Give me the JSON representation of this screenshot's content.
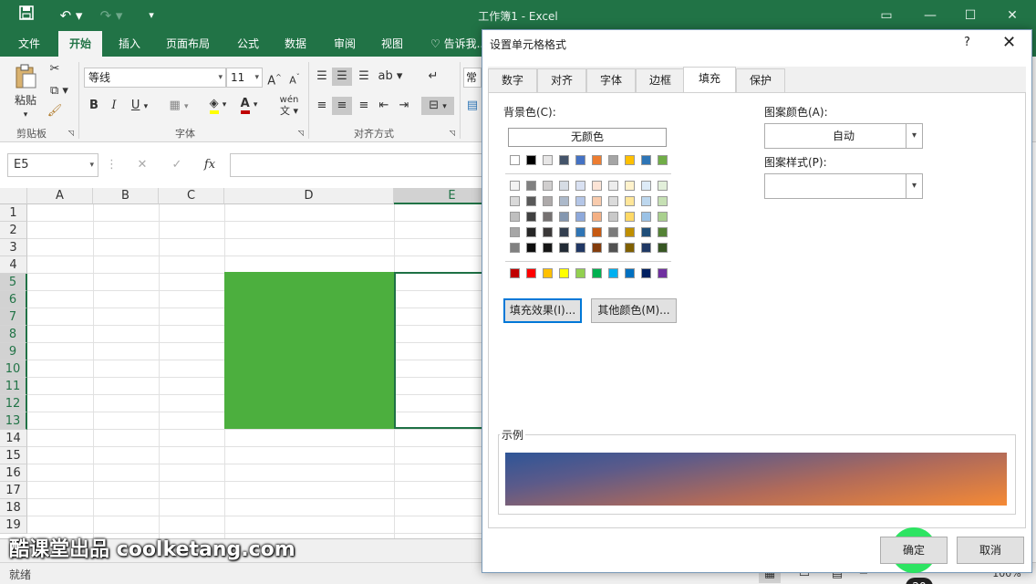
{
  "app": {
    "title": "工作簿1 - Excel"
  },
  "ribbon": {
    "tabs": [
      "文件",
      "开始",
      "插入",
      "页面布局",
      "公式",
      "数据",
      "审阅",
      "视图",
      "告诉我..."
    ],
    "paste_label": "粘贴",
    "clipboard_group": "剪贴板",
    "font_group": "字体",
    "align_group": "对齐方式",
    "font_name": "等线",
    "font_size": "11",
    "number_format": "常规",
    "wen_label": "wén",
    "font_color_glyph": "A",
    "fill_color_glyph": "A",
    "bold": "B",
    "italic": "I",
    "underline": "U",
    "grow_font": "A",
    "shrink_font": "A"
  },
  "formula_bar": {
    "name_box": "E5",
    "fx": "fx",
    "cancel": "✕",
    "enter": "✓"
  },
  "grid": {
    "columns": [
      "A",
      "B",
      "C",
      "D",
      "E"
    ],
    "rows": [
      "1",
      "2",
      "3",
      "4",
      "5",
      "6",
      "7",
      "8",
      "9",
      "10",
      "11",
      "12",
      "13",
      "14",
      "15",
      "16",
      "17",
      "18",
      "19"
    ],
    "selected_cell": "E5",
    "fill_color": "#4caf3e"
  },
  "status": {
    "ready": "就绪",
    "zoom": "100%"
  },
  "watermark": "酷课堂出品 coolketang.com",
  "dialog": {
    "title": "设置单元格格式",
    "help": "?",
    "tabs": [
      "数字",
      "对齐",
      "字体",
      "边框",
      "填充",
      "保护"
    ],
    "active_tab": "填充",
    "background_color_label": "背景色(C):",
    "no_color": "无颜色",
    "pattern_color_label": "图案颜色(A):",
    "pattern_color_value": "自动",
    "pattern_style_label": "图案样式(P):",
    "pattern_style_value": "",
    "fill_effects_button": "填充效果(I)...",
    "more_colors_button": "其他颜色(M)...",
    "sample_label": "示例",
    "ok_button": "确定",
    "cancel_button": "取消",
    "step_number": "20",
    "palette_top": [
      "#ffffff",
      "#000000",
      "#e7e6e6",
      "#44546a",
      "#4472c4",
      "#ed7d31",
      "#a5a5a5",
      "#ffc000",
      "#2e75b6",
      "#70ad47"
    ],
    "palette_tints": [
      [
        "#f2f2f2",
        "#808080",
        "#d0cece",
        "#d6dce4",
        "#d9e1f2",
        "#fce4d6",
        "#ededed",
        "#fff2cc",
        "#ddebf7",
        "#e2efda"
      ],
      [
        "#d9d9d9",
        "#595959",
        "#aeaaaa",
        "#acb9ca",
        "#b4c6e7",
        "#f8cbad",
        "#dbdbdb",
        "#ffe699",
        "#bdd7ee",
        "#c6e0b4"
      ],
      [
        "#bfbfbf",
        "#404040",
        "#757171",
        "#8497b0",
        "#8ea9db",
        "#f4b084",
        "#c9c9c9",
        "#ffd966",
        "#9bc2e6",
        "#a9d08e"
      ],
      [
        "#a6a6a6",
        "#262626",
        "#3a3838",
        "#333f4f",
        "#2f75b5",
        "#c65911",
        "#7b7b7b",
        "#bf8f00",
        "#1f4e78",
        "#548235"
      ],
      [
        "#808080",
        "#0d0d0d",
        "#161616",
        "#222b35",
        "#203764",
        "#833c0c",
        "#525252",
        "#806000",
        "#1f3864",
        "#375623"
      ]
    ],
    "palette_standard": [
      "#c00000",
      "#ff0000",
      "#ffc000",
      "#ffff00",
      "#92d050",
      "#00b050",
      "#00b0f0",
      "#0070c0",
      "#002060",
      "#7030a0"
    ]
  }
}
